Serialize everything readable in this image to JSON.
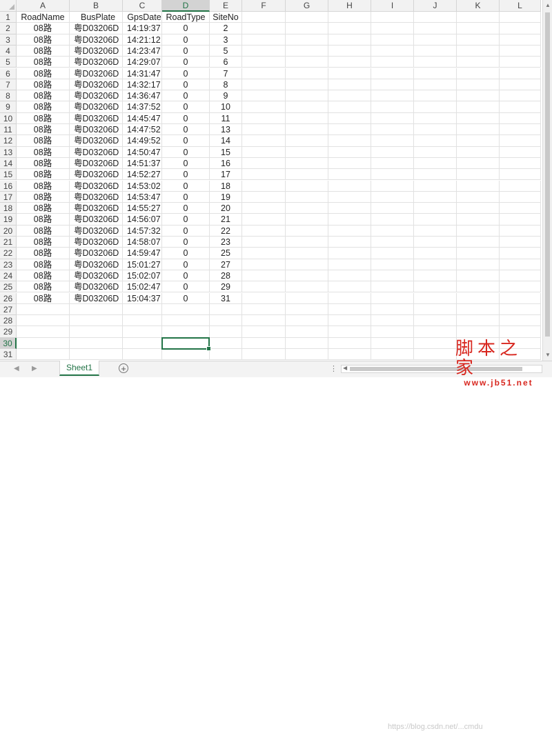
{
  "columns": [
    "A",
    "B",
    "C",
    "D",
    "E",
    "F",
    "G",
    "H",
    "I",
    "J",
    "K",
    "L"
  ],
  "selected_column": "D",
  "selected_row": 30,
  "row_numbers": [
    1,
    2,
    3,
    4,
    5,
    6,
    7,
    8,
    9,
    10,
    11,
    12,
    13,
    14,
    15,
    16,
    17,
    18,
    19,
    20,
    21,
    22,
    23,
    24,
    25,
    26,
    27,
    28,
    29,
    30,
    31
  ],
  "header_row": [
    "RoadName",
    "BusPlate",
    "GpsDate",
    "RoadType",
    "SiteNo"
  ],
  "rows": [
    [
      "08路",
      "粤D03206D",
      "14:19:37",
      "0",
      "2"
    ],
    [
      "08路",
      "粤D03206D",
      "14:21:12",
      "0",
      "3"
    ],
    [
      "08路",
      "粤D03206D",
      "14:23:47",
      "0",
      "5"
    ],
    [
      "08路",
      "粤D03206D",
      "14:29:07",
      "0",
      "6"
    ],
    [
      "08路",
      "粤D03206D",
      "14:31:47",
      "0",
      "7"
    ],
    [
      "08路",
      "粤D03206D",
      "14:32:17",
      "0",
      "8"
    ],
    [
      "08路",
      "粤D03206D",
      "14:36:47",
      "0",
      "9"
    ],
    [
      "08路",
      "粤D03206D",
      "14:37:52",
      "0",
      "10"
    ],
    [
      "08路",
      "粤D03206D",
      "14:45:47",
      "0",
      "11"
    ],
    [
      "08路",
      "粤D03206D",
      "14:47:52",
      "0",
      "13"
    ],
    [
      "08路",
      "粤D03206D",
      "14:49:52",
      "0",
      "14"
    ],
    [
      "08路",
      "粤D03206D",
      "14:50:47",
      "0",
      "15"
    ],
    [
      "08路",
      "粤D03206D",
      "14:51:37",
      "0",
      "16"
    ],
    [
      "08路",
      "粤D03206D",
      "14:52:27",
      "0",
      "17"
    ],
    [
      "08路",
      "粤D03206D",
      "14:53:02",
      "0",
      "18"
    ],
    [
      "08路",
      "粤D03206D",
      "14:53:47",
      "0",
      "19"
    ],
    [
      "08路",
      "粤D03206D",
      "14:55:27",
      "0",
      "20"
    ],
    [
      "08路",
      "粤D03206D",
      "14:56:07",
      "0",
      "21"
    ],
    [
      "08路",
      "粤D03206D",
      "14:57:32",
      "0",
      "22"
    ],
    [
      "08路",
      "粤D03206D",
      "14:58:07",
      "0",
      "23"
    ],
    [
      "08路",
      "粤D03206D",
      "14:59:47",
      "0",
      "25"
    ],
    [
      "08路",
      "粤D03206D",
      "15:01:27",
      "0",
      "27"
    ],
    [
      "08路",
      "粤D03206D",
      "15:02:07",
      "0",
      "28"
    ],
    [
      "08路",
      "粤D03206D",
      "15:02:47",
      "0",
      "29"
    ],
    [
      "08路",
      "粤D03206D",
      "15:04:37",
      "0",
      "31"
    ]
  ],
  "sheet_tab": "Sheet1",
  "add_sheet_glyph": "+",
  "tab_nav": {
    "prev": "◀",
    "next": "▶"
  },
  "bottom_dots": "⋮",
  "watermark": {
    "url_text": "https://blog.csdn.net/...cmdu",
    "logo_big": "脚本之家",
    "logo_small": "www.jb51.net"
  },
  "colors": {
    "accent": "#217346",
    "grid": "#e1e1e1",
    "header_bg": "#f2f2f2",
    "logo_red": "#d8271f"
  }
}
